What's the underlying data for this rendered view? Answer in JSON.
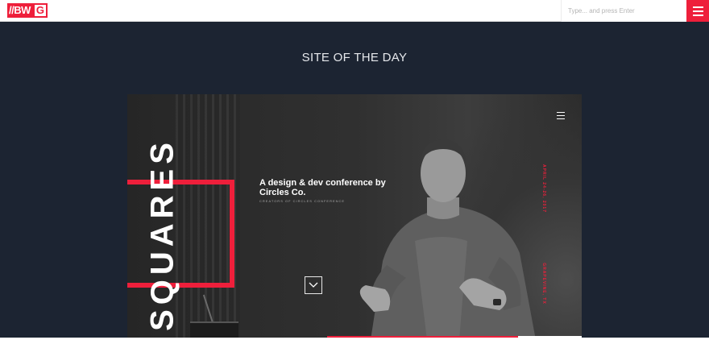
{
  "header": {
    "logo_left": "//BW",
    "logo_right": "G",
    "search_placeholder": "Type... and press Enter",
    "menu_icon": "hamburger-icon"
  },
  "main": {
    "section_title": "SITE OF THE DAY"
  },
  "featured_site": {
    "brand_word": "SQUARES",
    "headline": "A design & dev conference by Circles Co.",
    "subline": "CREATORS OF CIRCLES CONFERENCE",
    "date_text": "APRIL 24-26, 2017",
    "location_text": "GRAPEVINE, TX",
    "menu_icon": "hamburger-icon",
    "scroll_icon": "chevron-down-icon",
    "slide_progress": 0.75,
    "accent_color": "#ee1f3b"
  },
  "colors": {
    "brand_red": "#ee1f3b",
    "page_background": "#1c2432",
    "header_background": "#ffffff"
  }
}
